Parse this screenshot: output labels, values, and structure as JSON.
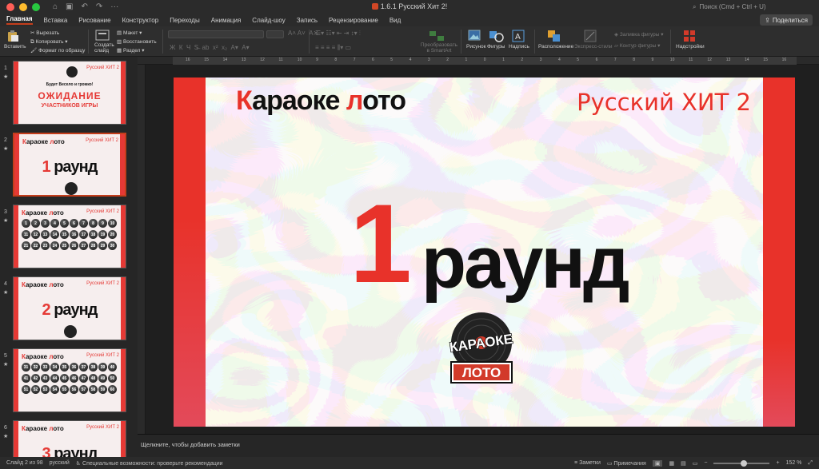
{
  "window": {
    "title": "1.6.1 Русский Хит 2!",
    "search_placeholder": "Поиск (Cmd + Ctrl + U)"
  },
  "tabs": [
    {
      "label": "Главная",
      "active": true
    },
    {
      "label": "Вставка"
    },
    {
      "label": "Рисование"
    },
    {
      "label": "Конструктор"
    },
    {
      "label": "Переходы"
    },
    {
      "label": "Анимация"
    },
    {
      "label": "Слайд-шоу"
    },
    {
      "label": "Запись"
    },
    {
      "label": "Рецензирование"
    },
    {
      "label": "Вид"
    }
  ],
  "share_label": "Поделиться",
  "ribbon": {
    "paste": "Вставить",
    "cut": "Вырезать",
    "copy": "Копировать",
    "format_painter": "Формат по образцу",
    "new_slide": "Создать слайд",
    "layout": "Макет",
    "reset": "Восстановить",
    "section": "Раздел",
    "smartart": "Преобразовать в SmartArt",
    "picture": "Рисунок",
    "shapes": "Фигуры",
    "textbox": "Надпись",
    "arrange": "Расположение",
    "quick_styles": "Экспресс-стили",
    "shape_fill": "Заливка фигуры",
    "shape_outline": "Контур фигуры",
    "addins": "Надстройки"
  },
  "ruler_numbers": [
    "16",
    "15",
    "14",
    "13",
    "12",
    "11",
    "10",
    "9",
    "8",
    "7",
    "6",
    "5",
    "4",
    "3",
    "2",
    "1",
    "0",
    "1",
    "2",
    "3",
    "4",
    "5",
    "6",
    "7",
    "8",
    "9",
    "10",
    "11",
    "12",
    "13",
    "14",
    "15",
    "16"
  ],
  "thumbnails": [
    {
      "num": "1",
      "kind": "intro",
      "brand_title": "Русский ХИТ 2",
      "line1": "Будет Весело и громко!",
      "line2": "ОЖИДАНИЕ",
      "line3": "УЧАСТНИКОВ ИГРЫ"
    },
    {
      "num": "2",
      "kind": "round",
      "selected": true,
      "title_red": "К",
      "title_a": "араоке ",
      "title_red2": "л",
      "title_b": "ото",
      "sub": "Русский ХИТ 2",
      "big_num": "1",
      "big_word": "раунд"
    },
    {
      "num": "3",
      "kind": "grid",
      "title_red": "К",
      "title_a": "араоке ",
      "title_red2": "л",
      "title_b": "ото",
      "sub": "Русский ХИТ 2",
      "balls": [
        "1",
        "2",
        "3",
        "4",
        "5",
        "6",
        "7",
        "8",
        "9",
        "10",
        "11",
        "12",
        "13",
        "14",
        "15",
        "16",
        "17",
        "18",
        "19",
        "20",
        "21",
        "22",
        "23",
        "24",
        "25",
        "26",
        "27",
        "28",
        "29",
        "30"
      ]
    },
    {
      "num": "4",
      "kind": "round",
      "title_red": "К",
      "title_a": "араоке ",
      "title_red2": "л",
      "title_b": "ото",
      "sub": "Русский ХИТ 2",
      "big_num": "2",
      "big_word": "раунд"
    },
    {
      "num": "5",
      "kind": "grid",
      "title_red": "К",
      "title_a": "араоке ",
      "title_red2": "л",
      "title_b": "ото",
      "sub": "Русский ХИТ 2",
      "balls": [
        "31",
        "32",
        "33",
        "34",
        "35",
        "36",
        "37",
        "38",
        "39",
        "40",
        "41",
        "42",
        "43",
        "44",
        "45",
        "46",
        "47",
        "48",
        "49",
        "50",
        "51",
        "52",
        "53",
        "54",
        "55",
        "56",
        "57",
        "58",
        "59",
        "60"
      ]
    },
    {
      "num": "6",
      "kind": "round",
      "title_red": "К",
      "title_a": "араоке ",
      "title_red2": "л",
      "title_b": "ото",
      "sub": "Русский ХИТ 2",
      "big_num": "3",
      "big_word": "раунд"
    }
  ],
  "slide": {
    "title_red": "К",
    "title_a": "араоке ",
    "title_red2": "л",
    "title_b": "ото",
    "subtitle": "Русский ХИТ 2",
    "big_num": "1",
    "big_word": "раунд",
    "logo_top": "КАРАОКЕ",
    "logo_bottom": "ЛОТО"
  },
  "notes_placeholder": "Щелкните, чтобы добавить заметки",
  "status": {
    "slide_info": "Слайд 2 из 98",
    "language": "русский",
    "accessibility": "Специальные возможности: проверьте рекомендации",
    "notes": "Заметки",
    "comments": "Примечания",
    "zoom": "152 %"
  },
  "colors": {
    "accent": "#c43e1c",
    "slide_red": "#e8322a"
  }
}
